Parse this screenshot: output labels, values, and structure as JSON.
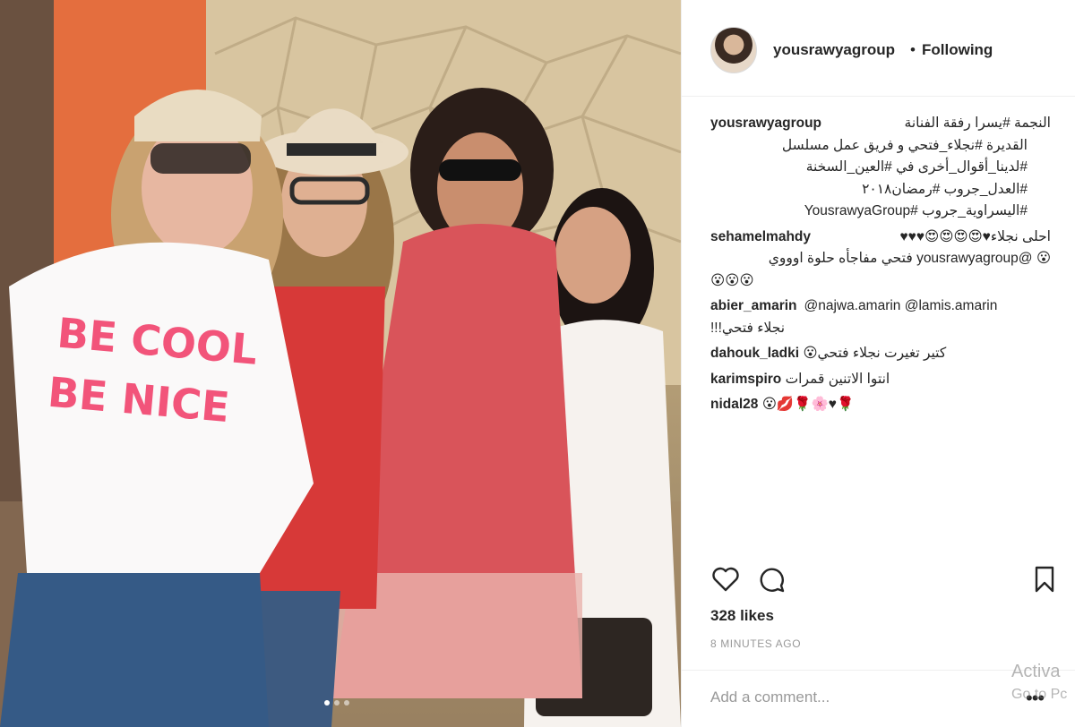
{
  "post": {
    "username": "yousrawyagroup",
    "separator": "•",
    "follow_status": "Following",
    "photo_text": "BE COOL BE NICE",
    "carousel": {
      "count": 3,
      "active_index": 0
    }
  },
  "comments": [
    {
      "user": "yousrawyagroup",
      "lines": [
        "النجمة #يسرا رفقة الفنانة",
        "القديرة #نجلاء_فتحي و فريق عمل مسلسل",
        "#لدينا_أقوال_أخرى في #العين_السخنة",
        "#العدل_جروب #رمضان٢٠١٨",
        "#اليسراوية_جروب #YousrawyaGroup"
      ]
    },
    {
      "user": "sehamelmahdy",
      "lines": [
        "احلى نجلاء♥😍😍😍😍♥♥♥",
        "😮 @yousrawyagroup فتحي مفاجأه حلوة اوووي",
        "😮😮😮"
      ]
    },
    {
      "user": "abier_amarin",
      "lines": [
        "@najwa.amarin @lamis.amarin",
        "نجلاء فتحي!!!"
      ]
    },
    {
      "user": "dahouk_ladki",
      "lines": [
        "😮كتير تغيرت نجلاء فتحي"
      ]
    },
    {
      "user": "karimspiro",
      "lines": [
        "انتوا الاتنين قمرات"
      ]
    },
    {
      "user": "nidal28",
      "lines": [
        "😮💋🌹🌸♥🌹"
      ]
    }
  ],
  "actions": {
    "like_icon": "heart-icon",
    "comment_icon": "comment-icon",
    "save_icon": "bookmark-icon"
  },
  "likes_text": "328 likes",
  "timestamp": "8 MINUTES AGO",
  "add_comment": {
    "placeholder": "Add a comment...",
    "more_label": "•••"
  },
  "watermark": {
    "line1": "Activa",
    "line2": "Go to Pc"
  },
  "colors": {
    "hashtag": "#003569",
    "text": "#262626",
    "muted": "#999999",
    "shirt_print": "#f2547a"
  }
}
